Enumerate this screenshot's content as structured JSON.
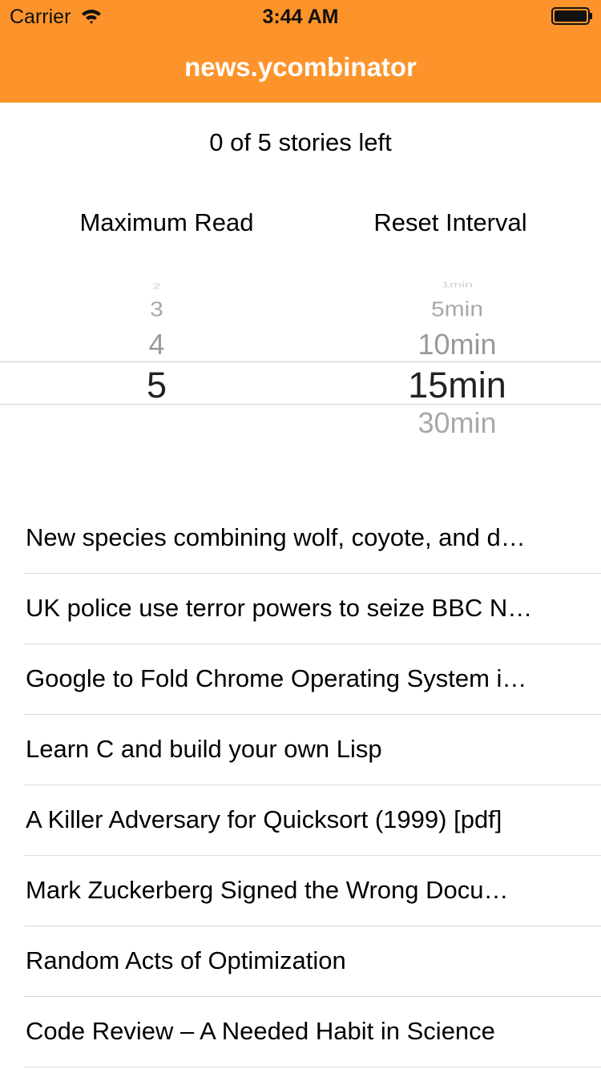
{
  "status_bar": {
    "carrier": "Carrier",
    "time": "3:44 AM"
  },
  "nav": {
    "title": "news.ycombinator"
  },
  "stories_left_text": "0 of 5 stories left",
  "picker": {
    "labels": {
      "maximum_read": "Maximum Read",
      "reset_interval": "Reset Interval"
    },
    "maximum_read": {
      "items": [
        "2",
        "3",
        "4",
        "5",
        ""
      ],
      "selected": "5"
    },
    "reset_interval": {
      "items": [
        "1min",
        "5min",
        "10min",
        "15min",
        "30min"
      ],
      "selected": "15min"
    }
  },
  "stories": [
    "New species combining wolf, coyote, and d…",
    "UK police use terror powers to seize BBC N…",
    "Google to Fold Chrome Operating System i…",
    "Learn C and build your own Lisp",
    "A Killer Adversary for Quicksort (1999) [pdf]",
    "Mark Zuckerberg Signed the Wrong Docu…",
    "Random Acts of Optimization",
    "Code Review – A Needed Habit in Science"
  ],
  "colors": {
    "nav_background": "#fd942b",
    "nav_title": "#ffffff"
  },
  "icons": [
    "wifi-icon",
    "battery-icon"
  ]
}
